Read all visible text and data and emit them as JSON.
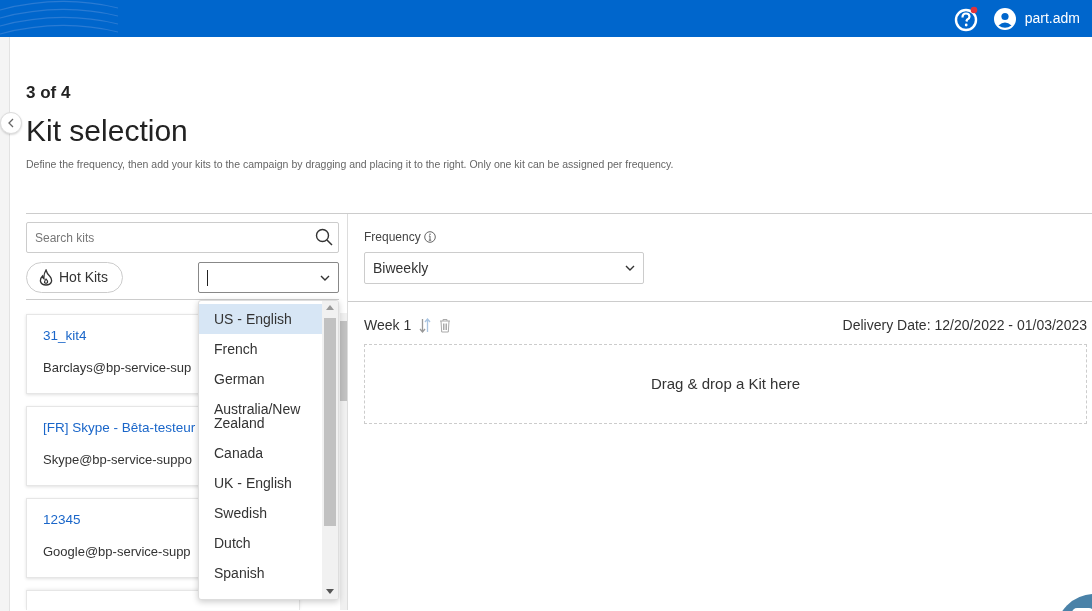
{
  "header": {
    "username": "part.adm",
    "help_notification": true
  },
  "step": "3 of 4",
  "title": "Kit selection",
  "description": "Define the frequency, then add your kits to the campaign by dragging and placing it to the right. Only one kit can be assigned per frequency.",
  "search": {
    "placeholder": "Search kits"
  },
  "hot_kits_button": "Hot Kits",
  "language_select": {
    "expanded": true,
    "options": [
      {
        "label": "US - English",
        "selected": true
      },
      {
        "label": "French",
        "selected": false
      },
      {
        "label": "German",
        "selected": false
      },
      {
        "label": "Australia/New Zealand",
        "selected": false
      },
      {
        "label": "Canada",
        "selected": false
      },
      {
        "label": "UK - English",
        "selected": false
      },
      {
        "label": "Swedish",
        "selected": false
      },
      {
        "label": "Dutch",
        "selected": false
      },
      {
        "label": "Spanish",
        "selected": false
      }
    ]
  },
  "kits": [
    {
      "name": "31_kit4",
      "email": "Barclays@bp-service-sup"
    },
    {
      "name": "[FR] Skype - Bêta-testeur",
      "email": "Skype@bp-service-suppo"
    },
    {
      "name": "12345",
      "email": "Google@bp-service-supp"
    }
  ],
  "frequency": {
    "label": "Frequency",
    "value": "Biweekly"
  },
  "weeks": [
    {
      "label": "Week 1",
      "delivery_date": "Delivery Date: 12/20/2022 - 01/03/2023",
      "drop_text": "Drag & drop a Kit here"
    }
  ]
}
